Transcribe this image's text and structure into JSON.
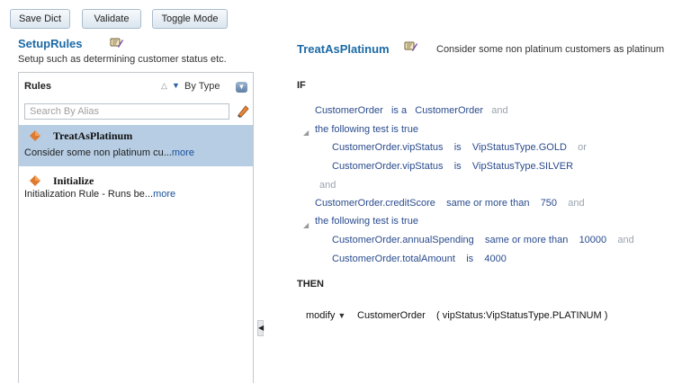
{
  "toolbar": {
    "save_label": "Save Dict",
    "validate_label": "Validate",
    "toggle_label": "Toggle Mode"
  },
  "ruleset": {
    "name": "SetupRules",
    "description": "Setup such as determining customer status etc."
  },
  "rules_panel": {
    "header": "Rules",
    "sort_label": "By Type",
    "search_placeholder": "Search By Alias",
    "items": [
      {
        "name": "TreatAsPlatinum",
        "desc": "Consider some non platinum cu...",
        "more": "more",
        "selected": true
      },
      {
        "name": "Initialize",
        "desc": "Initialization Rule - Runs be...",
        "more": "more",
        "selected": false
      }
    ]
  },
  "rule": {
    "name": "TreatAsPlatinum",
    "description": "Consider some non platinum customers as platinum",
    "if_label": "IF",
    "then_label": "THEN",
    "conditions": {
      "c1": {
        "left": "CustomerOrder",
        "op": "is a",
        "right": "CustomerOrder",
        "conj": "and"
      },
      "test1": "the following test is true",
      "c2": {
        "left": "CustomerOrder.vipStatus",
        "op": "is",
        "right": "VipStatusType.GOLD",
        "conj": "or"
      },
      "c3": {
        "left": "CustomerOrder.vipStatus",
        "op": "is",
        "right": "VipStatusType.SILVER"
      },
      "and1": "and",
      "c4": {
        "left": "CustomerOrder.creditScore",
        "op": "same or more than",
        "right": "750",
        "conj": "and"
      },
      "test2": "the following test is true",
      "c5": {
        "left": "CustomerOrder.annualSpending",
        "op": "same or more than",
        "right": "10000",
        "conj": "and"
      },
      "c6": {
        "left": "CustomerOrder.totalAmount",
        "op": "is",
        "right": "4000"
      }
    },
    "action": {
      "verb": "modify",
      "target": "CustomerOrder",
      "args": "( vipStatus:VipStatusType.PLATINUM )"
    }
  },
  "colors": {
    "title_blue": "#1c6aa6",
    "selected_row": "#b6cde3",
    "condition_text": "#2a4b8d",
    "conjunction_gray": "#9aa4ad"
  },
  "icons": [
    "dictionary-icon",
    "sort-ascending-icon",
    "sort-descending-icon",
    "dropdown-icon",
    "eraser-icon",
    "rule-diamond-icon",
    "collapse-triangle-icon",
    "splitter-collapse-icon"
  ]
}
